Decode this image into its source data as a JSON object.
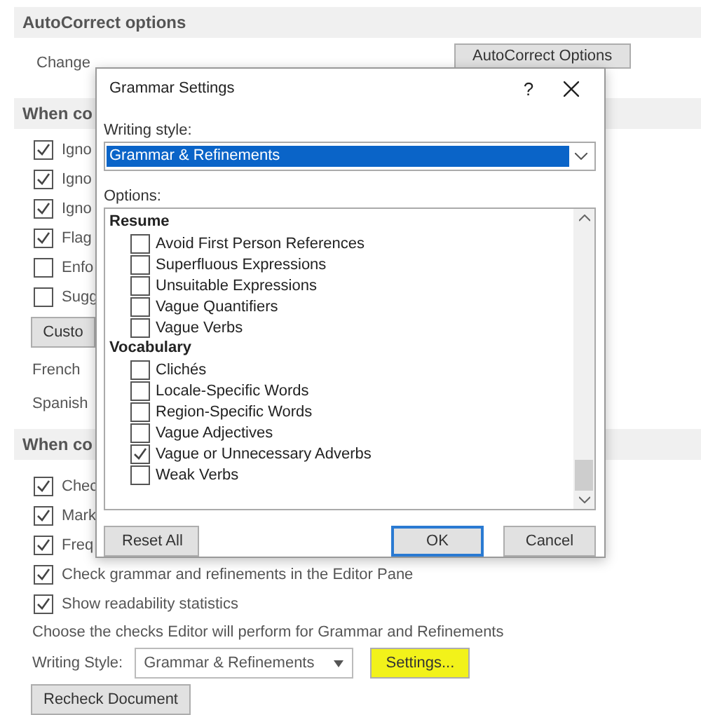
{
  "autocorrect": {
    "heading": "AutoCorrect options",
    "description": "Change",
    "button": "AutoCorrect Options"
  },
  "section_1": {
    "heading": "When co",
    "options": [
      {
        "label": "Igno",
        "checked": true
      },
      {
        "label": "Igno",
        "checked": true
      },
      {
        "label": "Igno",
        "checked": true
      },
      {
        "label": "Flag",
        "checked": true
      },
      {
        "label": "Enfo",
        "checked": false
      },
      {
        "label": "Sugg",
        "checked": false
      }
    ],
    "button": "Custo",
    "labels": [
      "French",
      "Spanish"
    ]
  },
  "section_2": {
    "heading": "When co",
    "options": [
      {
        "label": "Chec",
        "checked": true
      },
      {
        "label": "Mark",
        "checked": true
      },
      {
        "label": "Freq",
        "checked": true
      },
      {
        "label": "Check grammar and refinements in the Editor Pane",
        "checked": true
      },
      {
        "label": "Show readability statistics",
        "checked": true
      }
    ],
    "description": "Choose the checks Editor will perform for Grammar and Refinements",
    "writing_style": {
      "label": "Writing Style:",
      "value": "Grammar & Refinements"
    },
    "settings_button": {
      "label": "Settings...",
      "highlighted": true
    },
    "recheck_button": "Recheck Document"
  },
  "dialog": {
    "title": "Grammar Settings",
    "help": "?",
    "writing_style_label": "Writing style:",
    "writing_style_value": "Grammar & Refinements",
    "options_label": "Options:",
    "groups": [
      {
        "name": "Resume",
        "items": [
          {
            "label": "Avoid First Person References",
            "checked": false
          },
          {
            "label": "Superfluous Expressions",
            "checked": false
          },
          {
            "label": "Unsuitable Expressions",
            "checked": false
          },
          {
            "label": "Vague Quantifiers",
            "checked": false
          },
          {
            "label": "Vague Verbs",
            "checked": false
          }
        ]
      },
      {
        "name": "Vocabulary",
        "items": [
          {
            "label": "Clichés",
            "checked": false
          },
          {
            "label": "Locale-Specific Words",
            "checked": false
          },
          {
            "label": "Region-Specific Words",
            "checked": false
          },
          {
            "label": "Vague Adjectives",
            "checked": false
          },
          {
            "label": "Vague or Unnecessary Adverbs",
            "checked": true
          },
          {
            "label": "Weak Verbs",
            "checked": false
          }
        ]
      }
    ],
    "buttons": [
      {
        "label": "Reset All",
        "default": false
      },
      {
        "label": "OK",
        "default": true
      },
      {
        "label": "Cancel",
        "default": false
      }
    ]
  }
}
